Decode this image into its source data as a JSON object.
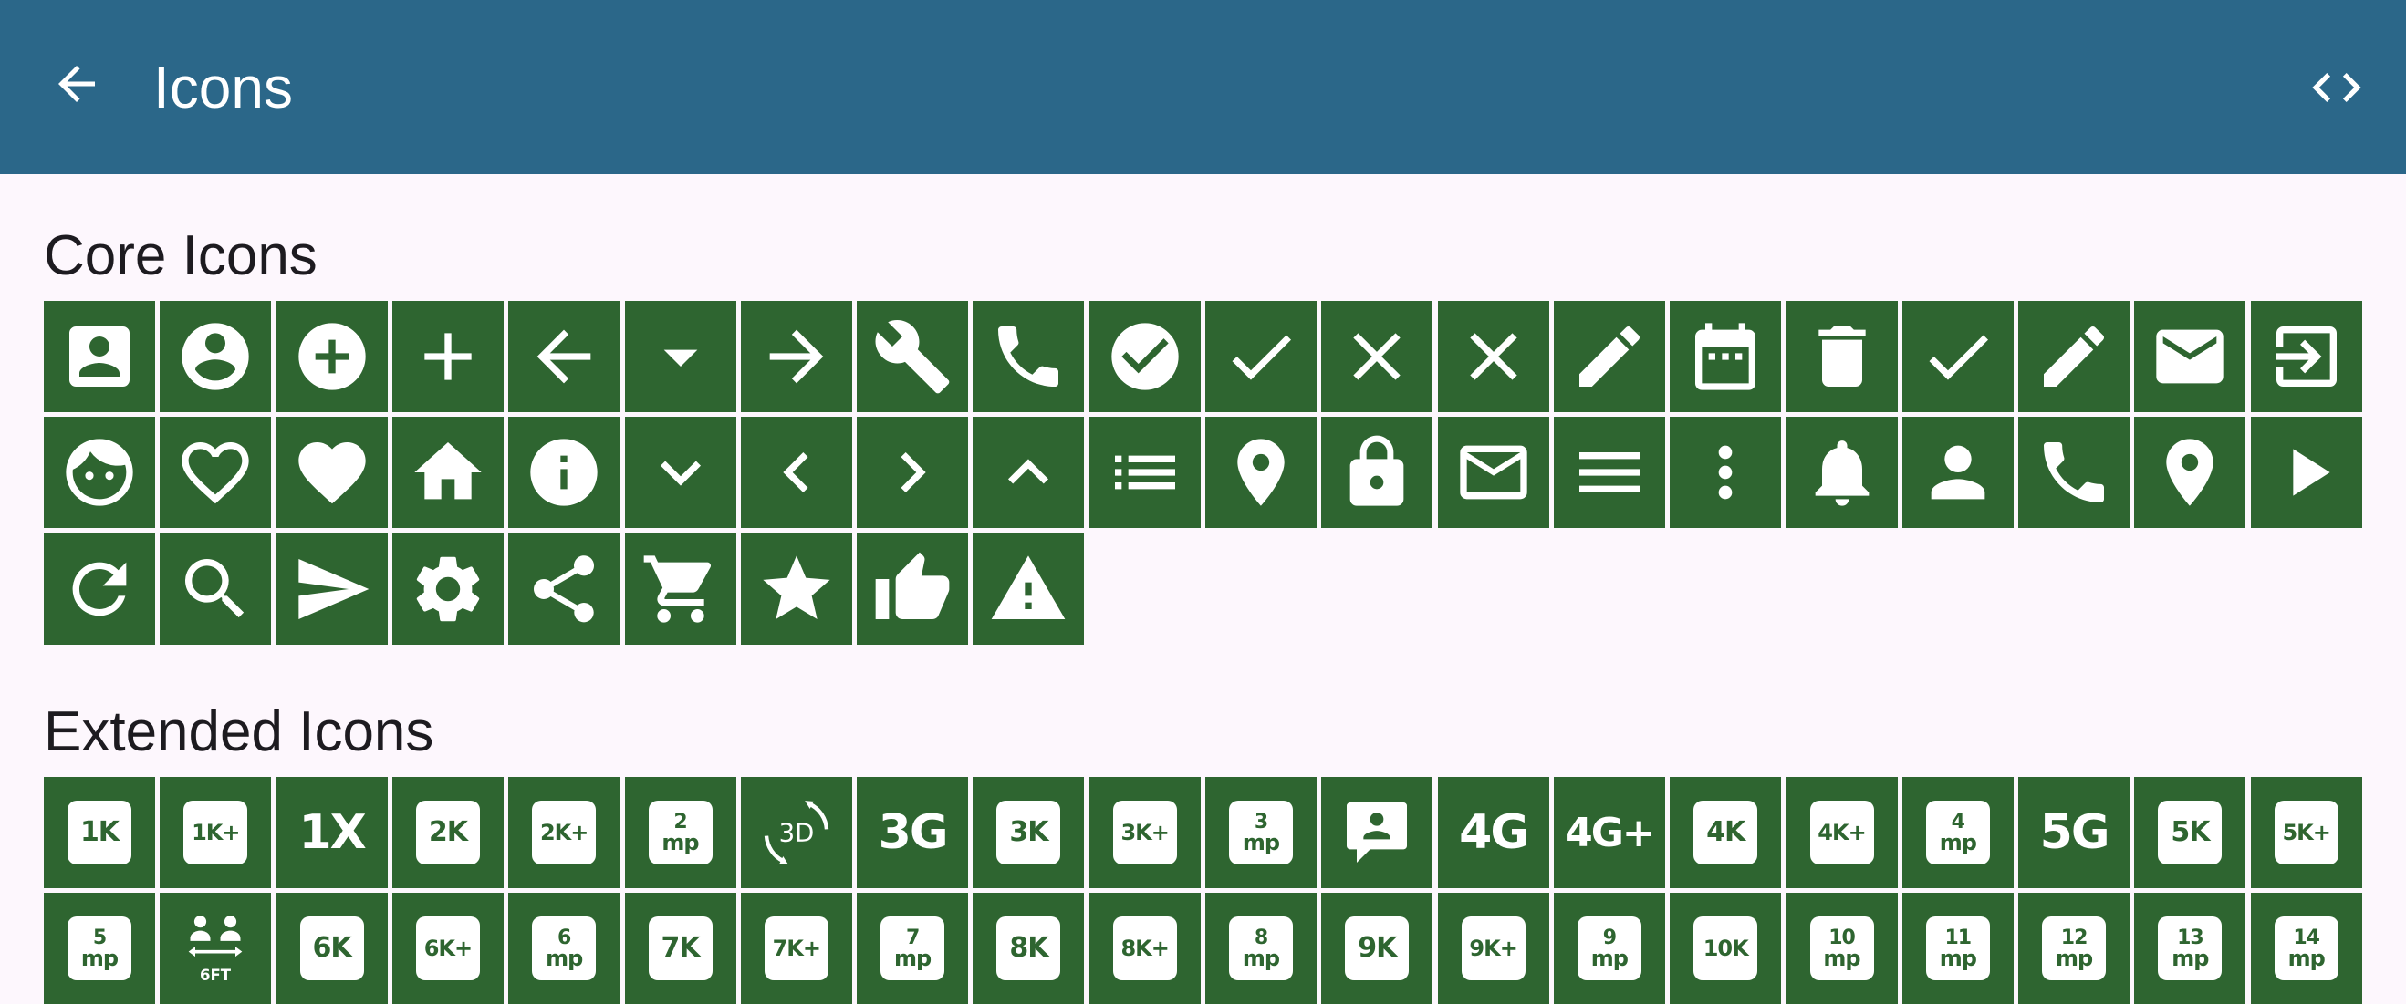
{
  "appbar": {
    "title": "Icons",
    "back_icon": "arrow-back-icon",
    "code_icon": "code-icon"
  },
  "core": {
    "title": "Core Icons",
    "icons": [
      "account-box",
      "account-circle",
      "add-circle",
      "add",
      "arrow-back",
      "arrow-drop-down",
      "arrow-forward",
      "build",
      "call",
      "check-circle",
      "check",
      "clear",
      "close",
      "create",
      "date-range",
      "delete",
      "done",
      "edit",
      "email",
      "exit-to-app",
      "face",
      "favorite-border",
      "favorite",
      "home",
      "info",
      "keyboard-arrow-down",
      "keyboard-arrow-left",
      "keyboard-arrow-right",
      "keyboard-arrow-up",
      "list",
      "location-on",
      "lock",
      "mail-outline",
      "menu",
      "more-vert",
      "notifications",
      "person",
      "phone",
      "place",
      "play-arrow",
      "refresh",
      "search",
      "send",
      "settings",
      "share",
      "shopping-cart",
      "star",
      "thumb-up",
      "warning"
    ]
  },
  "extended": {
    "title": "Extended Icons",
    "row1": [
      {
        "kind": "badge",
        "text": "1K"
      },
      {
        "kind": "badge",
        "text": "1K+"
      },
      {
        "kind": "plain",
        "text": "1X"
      },
      {
        "kind": "badge",
        "text": "2K"
      },
      {
        "kind": "badge",
        "text": "2K+"
      },
      {
        "kind": "mp",
        "num": "2",
        "unit": "mp"
      },
      {
        "kind": "rotate3d",
        "text": "3D"
      },
      {
        "kind": "plain",
        "text": "3G"
      },
      {
        "kind": "badge",
        "text": "3K"
      },
      {
        "kind": "badge",
        "text": "3K+"
      },
      {
        "kind": "mp",
        "num": "3",
        "unit": "mp"
      },
      {
        "kind": "contact-bubble",
        "text": ""
      },
      {
        "kind": "plain",
        "text": "4G"
      },
      {
        "kind": "plain",
        "text": "4G+"
      },
      {
        "kind": "badge",
        "text": "4K"
      },
      {
        "kind": "badge",
        "text": "4K+"
      },
      {
        "kind": "mp",
        "num": "4",
        "unit": "mp"
      },
      {
        "kind": "plain",
        "text": "5G"
      },
      {
        "kind": "badge",
        "text": "5K"
      },
      {
        "kind": "badge",
        "text": "5K+"
      }
    ],
    "row2": [
      {
        "kind": "mp",
        "num": "5",
        "unit": "mp"
      },
      {
        "kind": "sixft",
        "text": "6FT"
      },
      {
        "kind": "badge",
        "text": "6K"
      },
      {
        "kind": "badge",
        "text": "6K+"
      },
      {
        "kind": "mp",
        "num": "6",
        "unit": "mp"
      },
      {
        "kind": "badge",
        "text": "7K"
      },
      {
        "kind": "badge",
        "text": "7K+"
      },
      {
        "kind": "mp",
        "num": "7",
        "unit": "mp"
      },
      {
        "kind": "badge",
        "text": "8K"
      },
      {
        "kind": "badge",
        "text": "8K+"
      },
      {
        "kind": "mp",
        "num": "8",
        "unit": "mp"
      },
      {
        "kind": "badge",
        "text": "9K"
      },
      {
        "kind": "badge",
        "text": "9K+"
      },
      {
        "kind": "mp",
        "num": "9",
        "unit": "mp"
      },
      {
        "kind": "badge",
        "text": "10K"
      },
      {
        "kind": "mp",
        "num": "10",
        "unit": "mp"
      },
      {
        "kind": "mp",
        "num": "11",
        "unit": "mp"
      },
      {
        "kind": "mp",
        "num": "12",
        "unit": "mp"
      },
      {
        "kind": "mp",
        "num": "13",
        "unit": "mp"
      },
      {
        "kind": "mp",
        "num": "14",
        "unit": "mp"
      }
    ]
  },
  "colors": {
    "appbar": "#2B6789",
    "tile": "#2E6530",
    "background": "#FDF7FD"
  }
}
